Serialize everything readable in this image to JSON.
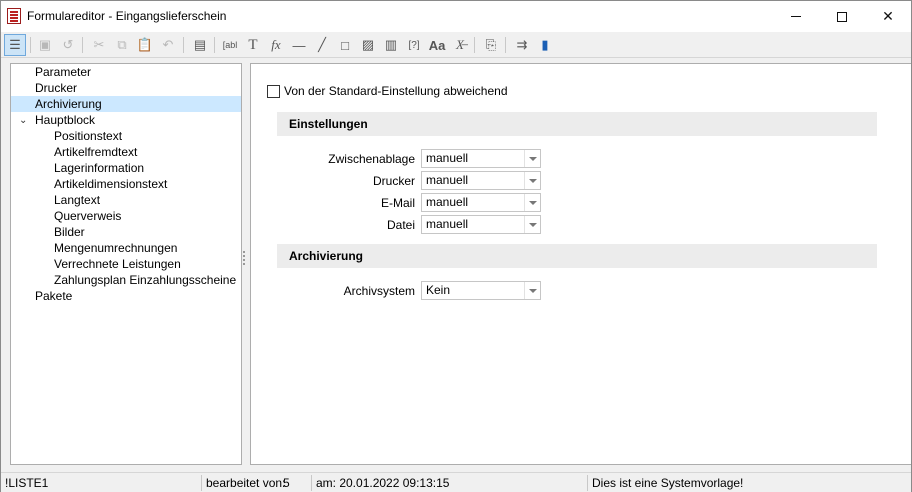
{
  "window": {
    "title": "Formulareditor - Eingangslieferschein",
    "controls": {
      "minimize": "minimize-icon",
      "maximize": "maximize-icon",
      "close": "close-icon"
    }
  },
  "toolbar": {
    "buttons": [
      "tree-view-icon",
      "save-icon",
      "revert-icon",
      "cut-icon",
      "copy-icon",
      "paste-icon",
      "undo-icon",
      "properties-icon",
      "text-field-icon",
      "text-icon",
      "formula-icon",
      "horizontal-line-icon",
      "diagonal-line-icon",
      "rectangle-icon",
      "image-icon",
      "barcode-icon",
      "variable-icon",
      "font-icon",
      "clear-format-icon",
      "package-icon",
      "export-icon",
      "save-template-icon"
    ]
  },
  "tree": {
    "items": [
      {
        "label": "Parameter"
      },
      {
        "label": "Drucker"
      },
      {
        "label": "Archivierung",
        "selected": true
      },
      {
        "label": "Hauptblock",
        "expanded": true
      },
      {
        "label": "Positionstext"
      },
      {
        "label": "Artikelfremdtext"
      },
      {
        "label": "Lagerinformation"
      },
      {
        "label": "Artikeldimensionstext"
      },
      {
        "label": "Langtext"
      },
      {
        "label": "Querverweis"
      },
      {
        "label": "Bilder"
      },
      {
        "label": "Mengenumrechnungen"
      },
      {
        "label": "Verrechnete Leistungen"
      },
      {
        "label": "Zahlungsplan Einzahlungsscheine"
      },
      {
        "label": "Pakete"
      }
    ]
  },
  "content": {
    "override_checkbox": {
      "label": "Von der Standard-Einstellung abweichend",
      "checked": false
    },
    "sections": {
      "einstellungen": {
        "title": "Einstellungen",
        "fields": [
          {
            "label": "Zwischenablage",
            "value": "manuell"
          },
          {
            "label": "Drucker",
            "value": "manuell"
          },
          {
            "label": "E-Mail",
            "value": "manuell"
          },
          {
            "label": "Datei",
            "value": "manuell"
          }
        ]
      },
      "archivierung": {
        "title": "Archivierung",
        "fields": [
          {
            "label": "Archivsystem",
            "value": "Kein"
          }
        ]
      }
    }
  },
  "statusbar": {
    "name": "!LISTE1",
    "edited_by_label": "bearbeitet von:",
    "edited_by_value": "5",
    "date": "am: 20.01.2022 09:13:15",
    "note": "Dies ist eine Systemvorlage!"
  },
  "colors": {
    "selection": "#cce8ff",
    "section_header_bg": "#ececec",
    "toolbar_active": "#cce4f7"
  }
}
